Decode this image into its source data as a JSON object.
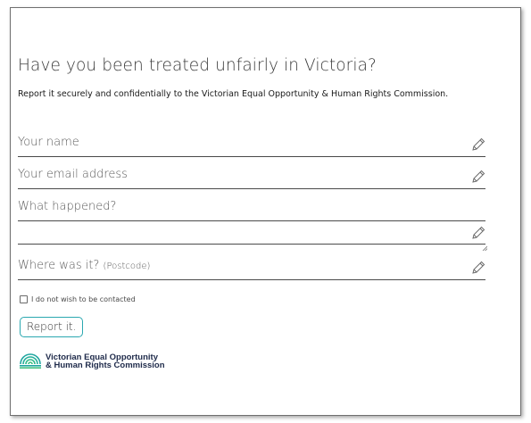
{
  "form": {
    "title": "Have you been treated unfairly in Victoria?",
    "subtitle": "Report it securely and confidentially to the Victorian Equal Opportunity & Human Rights Commission.",
    "fields": [
      {
        "placeholder": "Your name",
        "icon": "pencil-icon"
      },
      {
        "placeholder": "Your email address",
        "icon": "pencil-icon"
      },
      {
        "placeholder": "What happened?",
        "icon": "pencil-icon"
      },
      {
        "placeholder": "Where was it?",
        "hint": "(Postcode)",
        "icon": "pencil-icon"
      }
    ],
    "checkbox_label": "I do not wish to be contacted",
    "submit_label": "Report it."
  },
  "logo": {
    "line1": "Victorian Equal Opportunity",
    "line2": "& Human Rights Commission"
  },
  "colors": {
    "accent": "#2aa8b0",
    "logo_text": "#1e2a4a",
    "logo_teal": "#1fa5a0",
    "logo_green": "#3fbf7f"
  }
}
